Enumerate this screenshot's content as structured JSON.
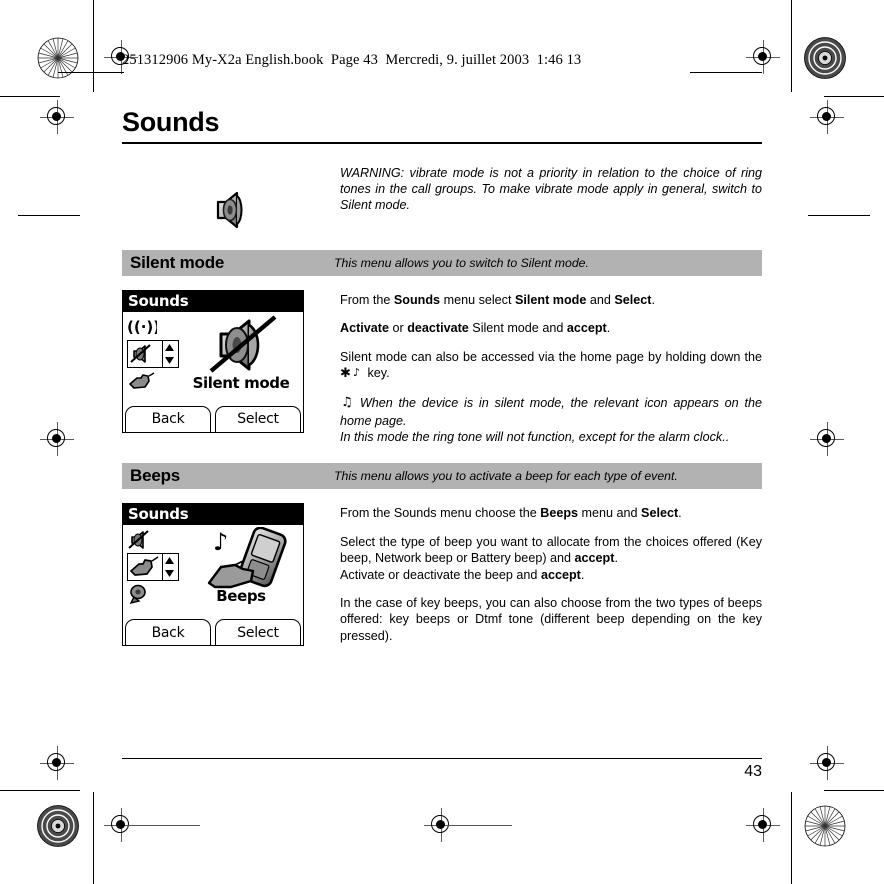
{
  "document": {
    "file_header": "251312906 My-X2a English.book  Page 43  Mercredi, 9. juillet 2003  1:46 13",
    "chapter_title": "Sounds",
    "page_number": "43"
  },
  "warning": {
    "icon": "loudspeaker-icon",
    "text": "WARNING: vibrate mode is not a priority in relation to the choice of ring tones in the call groups. To make vibrate mode apply in general, switch to Silent mode."
  },
  "sections": [
    {
      "id": "silent-mode",
      "title": "Silent mode",
      "subtitle": "This menu allows you to switch to Silent mode.",
      "screenshot": {
        "title": "Sounds",
        "label": "Silent mode",
        "softkey_left": "Back",
        "softkey_right": "Select",
        "rail_icons": [
          "network-waves-icon",
          "silent-mode-icon",
          "hand-beep-icon"
        ],
        "main_icon": "speaker-crossed-out-icon"
      },
      "paragraphs": [
        {
          "id": "p1",
          "runs": [
            {
              "t": "From the ",
              "b": false
            },
            {
              "t": "Sounds",
              "b": true
            },
            {
              "t": " menu select ",
              "b": false
            },
            {
              "t": "Silent mode",
              "b": true
            },
            {
              "t": "  and ",
              "b": false
            },
            {
              "t": "Select",
              "b": true
            },
            {
              "t": ".",
              "b": false
            }
          ]
        },
        {
          "id": "p2",
          "runs": [
            {
              "t": "Activate",
              "b": true
            },
            {
              "t": " or ",
              "b": false
            },
            {
              "t": "deactivate",
              "b": true
            },
            {
              "t": " Silent mode and ",
              "b": false
            },
            {
              "t": "accept",
              "b": true
            },
            {
              "t": ".",
              "b": false
            }
          ]
        },
        {
          "id": "p3",
          "runs": [
            {
              "t": "Silent mode can also be accessed via the home page by holding down the ",
              "b": false
            },
            {
              "t": "∗ ♪",
              "b": false,
              "glyph": true
            },
            {
              "t": " key.",
              "b": false
            }
          ]
        }
      ],
      "note": {
        "glyph": "musical-note-icon",
        "line1": "When the device is in silent mode, the relevant icon appears on the home page.",
        "line2": "In this mode the ring tone will not function, except for the alarm clock.."
      }
    },
    {
      "id": "beeps",
      "title": "Beeps",
      "subtitle": "This menu allows you to activate a beep for each type of event.",
      "screenshot": {
        "title": "Sounds",
        "label": "Beeps",
        "softkey_left": "Back",
        "softkey_right": "Select",
        "rail_icons": [
          "silent-mode-icon",
          "hand-beep-icon",
          "ring-tones-icon"
        ],
        "main_icon": "hand-holding-phone-icon"
      },
      "paragraphs": [
        {
          "id": "p1",
          "runs": [
            {
              "t": "From the Sounds menu choose the ",
              "b": false
            },
            {
              "t": "Beeps",
              "b": true
            },
            {
              "t": " menu and ",
              "b": false
            },
            {
              "t": "Select",
              "b": true
            },
            {
              "t": ".",
              "b": false
            }
          ]
        },
        {
          "id": "p2",
          "runs": [
            {
              "t": "Select the type of beep you want to allocate from the choices offered (Key beep, Network beep or Battery beep) and ",
              "b": false
            },
            {
              "t": "accept",
              "b": true
            },
            {
              "t": ".",
              "b": false
            },
            {
              "t": "\n",
              "b": false,
              "br": true
            },
            {
              "t": "Activate or deactivate the beep and ",
              "b": false
            },
            {
              "t": "accept",
              "b": true
            },
            {
              "t": ".",
              "b": false
            }
          ]
        },
        {
          "id": "p3",
          "runs": [
            {
              "t": "In the case of key beeps, you can also choose from the two types of beeps offered: key beeps or Dtmf tone (different beep depending on the key pressed).",
              "b": false
            }
          ]
        }
      ]
    }
  ],
  "colors": {
    "section_bar_bg": "#b2b2b2",
    "text": "#000000",
    "page_bg": "#ffffff"
  },
  "print_marks": {
    "registration": "registration-crosshair",
    "burst": "star-burst-mark",
    "target": "concentric-target-mark"
  }
}
